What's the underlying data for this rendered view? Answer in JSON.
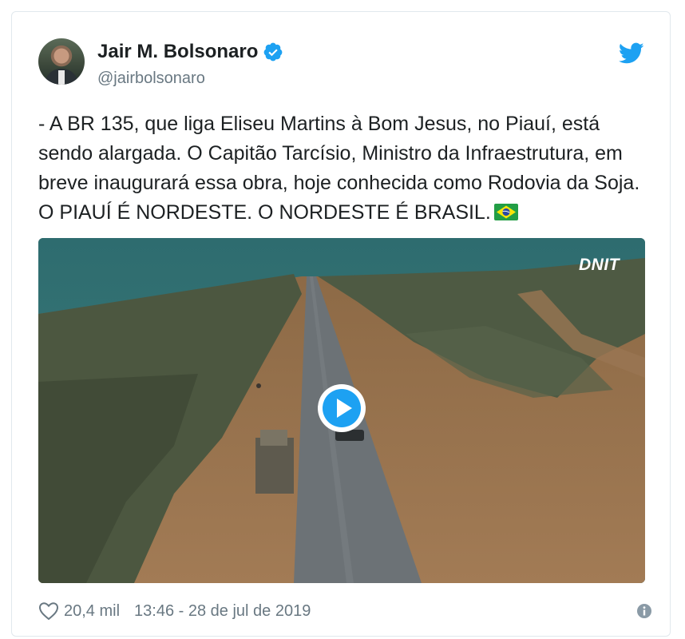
{
  "tweet": {
    "author_name": "Jair M. Bolsonaro",
    "author_handle": "@jairbolsonaro",
    "text": "- A BR 135, que liga Eliseu Martins à Bom Jesus, no Piauí, está sendo alargada. O Capitão Tarcísio, Ministro da Infraestrutura, em breve inaugurará essa obra, hoje conhecida como Rodovia da Soja. O PIAUÍ É NORDESTE. O NORDESTE É BRASIL.",
    "flag_icon": "brazil-flag-emoji",
    "media_watermark": "DNIT",
    "likes": "20,4 mil",
    "timestamp": "13:46 - 28 de jul de 2019"
  },
  "icons": {
    "verified": "verified-badge-icon",
    "brand": "twitter-bird-icon",
    "play": "play-icon",
    "like": "heart-icon",
    "info": "info-icon"
  },
  "colors": {
    "twitter_blue": "#1da1f2",
    "text": "#1c2022",
    "muted": "#697882",
    "border": "#e1e8ed"
  }
}
